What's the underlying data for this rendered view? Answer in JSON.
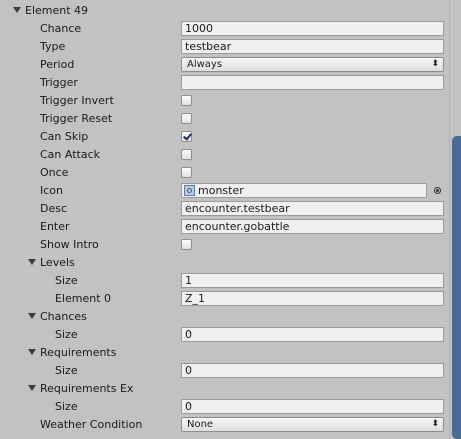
{
  "element": {
    "header": "Element 49",
    "chance": {
      "label": "Chance",
      "value": "1000"
    },
    "type": {
      "label": "Type",
      "value": "testbear"
    },
    "period": {
      "label": "Period",
      "value": "Always"
    },
    "trigger": {
      "label": "Trigger",
      "value": ""
    },
    "trigger_invert": {
      "label": "Trigger Invert",
      "checked": false
    },
    "trigger_reset": {
      "label": "Trigger Reset",
      "checked": false
    },
    "can_skip": {
      "label": "Can Skip",
      "checked": true
    },
    "can_attack": {
      "label": "Can Attack",
      "checked": false
    },
    "once": {
      "label": "Once",
      "checked": false
    },
    "icon": {
      "label": "Icon",
      "value": "monster"
    },
    "desc": {
      "label": "Desc",
      "value": "encounter.testbear"
    },
    "enter": {
      "label": "Enter",
      "value": "encounter.gobattle"
    },
    "show_intro": {
      "label": "Show Intro",
      "checked": false
    },
    "levels": {
      "label": "Levels",
      "size_label": "Size",
      "size": "1",
      "element0_label": "Element 0",
      "element0": "Z_1"
    },
    "chances": {
      "label": "Chances",
      "size_label": "Size",
      "size": "0"
    },
    "requirements": {
      "label": "Requirements",
      "size_label": "Size",
      "size": "0"
    },
    "requirements_ex": {
      "label": "Requirements Ex",
      "size_label": "Size",
      "size": "0"
    },
    "weather": {
      "label": "Weather Condition",
      "value": "None"
    }
  }
}
